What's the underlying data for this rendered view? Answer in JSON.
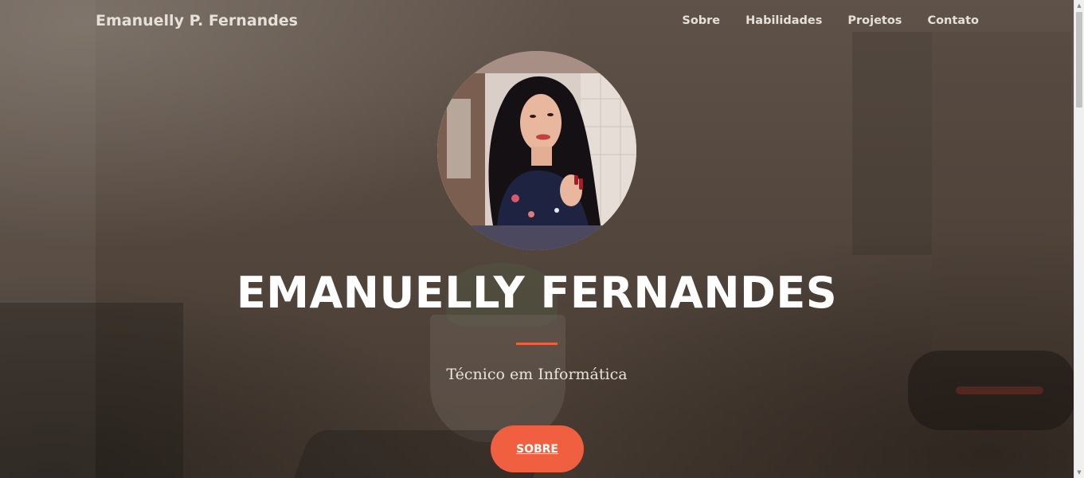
{
  "navbar": {
    "brand": "Emanuelly P. Fernandes",
    "links": [
      "Sobre",
      "Habilidades",
      "Projetos",
      "Contato"
    ]
  },
  "hero": {
    "title": "EMANUELLY FERNANDES",
    "subtitle": "Técnico em Informática",
    "button_label": "SOBRE",
    "avatar_alt": ""
  },
  "colors": {
    "accent": "#f05f40",
    "text": "#ffffff",
    "nav_text": "#e6e0da"
  },
  "icons": {
    "scroll_up": "triangle-up-icon",
    "scroll_down": "triangle-down-icon"
  }
}
